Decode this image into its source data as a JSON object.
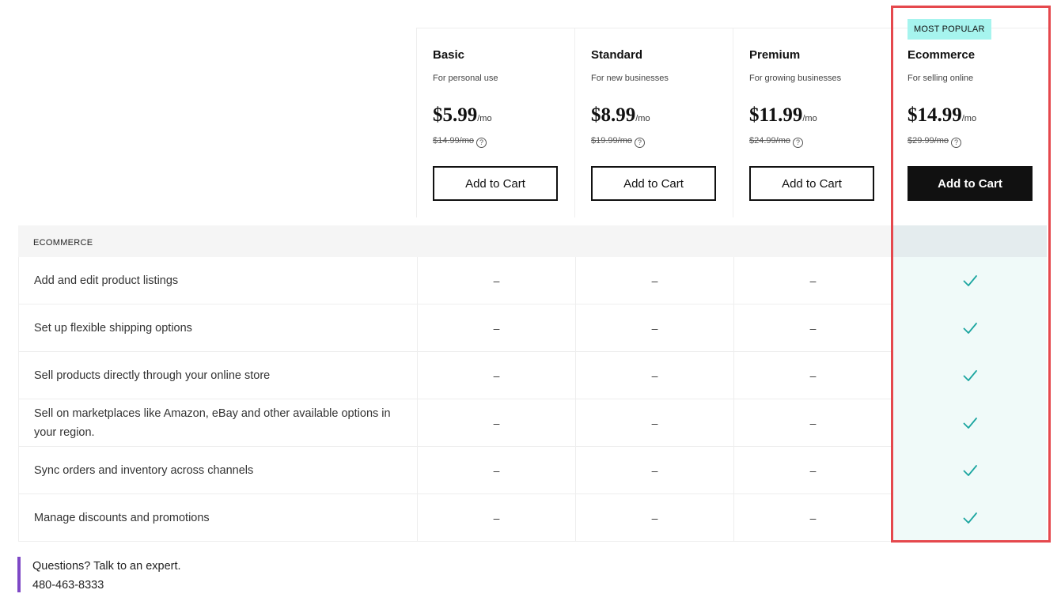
{
  "plans": [
    {
      "name": "Basic",
      "subtitle": "For personal use",
      "price": "$5.99",
      "per": "/mo",
      "original": "$14.99/mo",
      "cta": "Add to Cart"
    },
    {
      "name": "Standard",
      "subtitle": "For new businesses",
      "price": "$8.99",
      "per": "/mo",
      "original": "$19.99/mo",
      "cta": "Add to Cart"
    },
    {
      "name": "Premium",
      "subtitle": "For growing businesses",
      "price": "$11.99",
      "per": "/mo",
      "original": "$24.99/mo",
      "cta": "Add to Cart"
    },
    {
      "name": "Ecommerce",
      "subtitle": "For selling online",
      "price": "$14.99",
      "per": "/mo",
      "original": "$29.99/mo",
      "cta": "Add to Cart",
      "badge": "MOST POPULAR"
    }
  ],
  "section": {
    "label": "ECOMMERCE"
  },
  "features": [
    {
      "label": "Add and edit product listings",
      "values": [
        "–",
        "–",
        "–",
        "check"
      ]
    },
    {
      "label": "Set up flexible shipping options",
      "values": [
        "–",
        "–",
        "–",
        "check"
      ]
    },
    {
      "label": "Sell products directly through your online store",
      "values": [
        "–",
        "–",
        "–",
        "check"
      ]
    },
    {
      "label": "Sell on marketplaces like Amazon, eBay and other available options in your region.",
      "values": [
        "–",
        "–",
        "–",
        "check"
      ]
    },
    {
      "label": "Sync orders and inventory across channels",
      "values": [
        "–",
        "–",
        "–",
        "check"
      ]
    },
    {
      "label": "Manage discounts and promotions",
      "values": [
        "–",
        "–",
        "–",
        "check"
      ]
    }
  ],
  "footer": {
    "question": "Questions? Talk to an expert.",
    "phone": "480-463-8333"
  },
  "colors": {
    "check": "#1ba5a0",
    "badge_bg": "#a6f4ee",
    "highlight": "#e5484d",
    "accent_bar": "#7e48c6"
  },
  "help_icon": "?"
}
